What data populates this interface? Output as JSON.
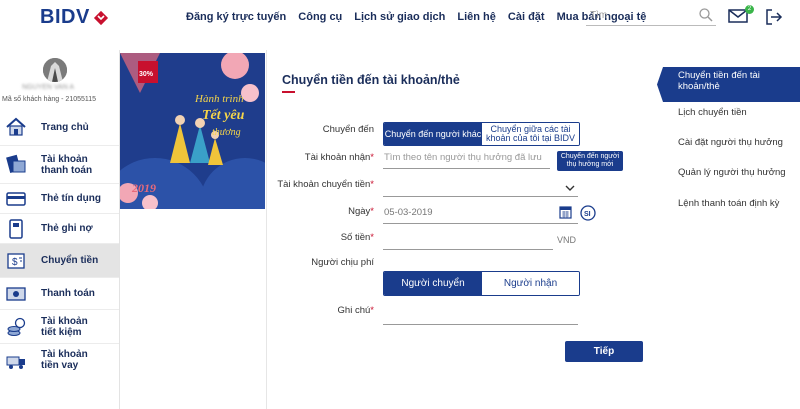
{
  "header": {
    "logo_text": "BIDV",
    "nav": [
      "Đăng ký trực tuyến",
      "Công cụ",
      "Lịch sử giao dịch",
      "Liên hệ",
      "Cài đặt",
      "Mua bán ngoại tệ"
    ],
    "search_placeholder": "Tìm",
    "mail_count": "2"
  },
  "sidebar": {
    "customer_id_label": "Mã số khách hàng - 21055115",
    "user_name": "NGUYEN VAN A",
    "items": [
      {
        "label": "Trang chủ",
        "icon": "home-icon"
      },
      {
        "label": "Tài khoản thanh toán",
        "icon": "wallet-icon"
      },
      {
        "label": "Thẻ tín dụng",
        "icon": "credit-card-icon"
      },
      {
        "label": "Thẻ ghi nợ",
        "icon": "debit-card-icon"
      },
      {
        "label": "Chuyển tiền",
        "icon": "transfer-icon"
      },
      {
        "label": "Thanh toán",
        "icon": "payment-icon"
      },
      {
        "label": "Tài khoản tiết kiệm",
        "icon": "savings-icon"
      },
      {
        "label": "Tài khoản tiền vay",
        "icon": "loan-icon"
      }
    ]
  },
  "banner": {
    "discount": "30%",
    "line1": "Hành trình",
    "line2": "Tết yêu",
    "line3": "thương",
    "year": "2019"
  },
  "form": {
    "title": "Chuyển tiền đến tài khoản/thẻ",
    "transfer_to_label": "Chuyển đến",
    "transfer_to_option_other": "Chuyển đến người khác",
    "transfer_to_option_own": "Chuyển giữa các tài khoản của tôi tại BIDV",
    "recipient_label": "Tài khoản nhận",
    "recipient_placeholder": "Tìm theo tên người thụ hưởng đã lưu",
    "new_recipient_button": "Chuyển đến người thụ hưởng mới",
    "source_account_label": "Tài khoản chuyển tiền",
    "date_label": "Ngày",
    "date_value": "05-03-2019",
    "amount_label": "Số tiền",
    "currency": "VND",
    "fee_payer_label": "Người chịu phí",
    "fee_payer_sender": "Người chuyển",
    "fee_payer_receiver": "Người nhận",
    "note_label": "Ghi chú",
    "next_button": "Tiếp"
  },
  "rightbar": {
    "items": [
      "Chuyển tiền đến tài khoản/thẻ",
      "Lịch chuyển tiền",
      "Cài đặt người thụ hưởng",
      "Quản lý người thụ hưởng",
      "Lệnh thanh toán định kỳ"
    ]
  },
  "colors": {
    "brand": "#1a3c8c",
    "accent": "#c8102e",
    "fee_green": "#3ab54a"
  }
}
